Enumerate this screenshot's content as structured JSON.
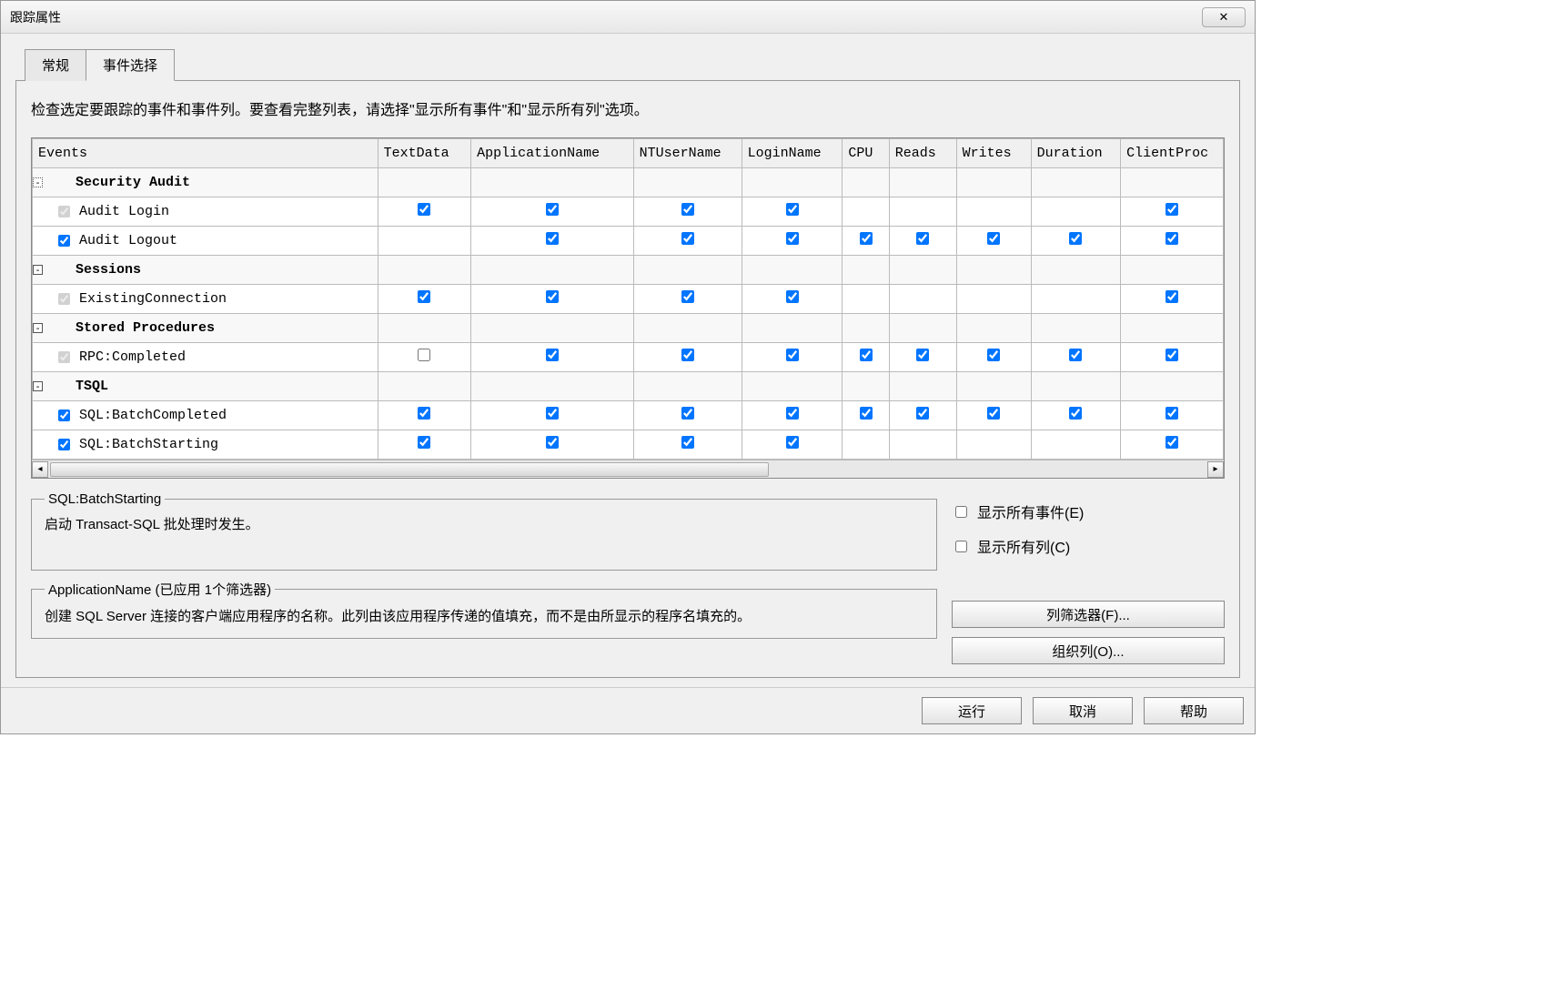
{
  "window": {
    "title": "跟踪属性",
    "close_glyph": "✕"
  },
  "tabs": {
    "general": "常规",
    "events": "事件选择"
  },
  "instruction": "检查选定要跟踪的事件和事件列。要查看完整列表，请选择\"显示所有事件\"和\"显示所有列\"选项。",
  "columns": {
    "events": "Events",
    "textdata": "TextData",
    "appname": "ApplicationName",
    "ntuser": "NTUserName",
    "login": "LoginName",
    "cpu": "CPU",
    "reads": "Reads",
    "writes": "Writes",
    "duration": "Duration",
    "client": "ClientProc"
  },
  "groups": [
    {
      "label": "Security Audit"
    },
    {
      "label": "Sessions"
    },
    {
      "label": "Stored Procedures"
    },
    {
      "label": "TSQL"
    }
  ],
  "rows": [
    {
      "group": 0,
      "label": "Audit Login",
      "chk": true,
      "disabled": true,
      "cells": {
        "textdata": true,
        "appname": true,
        "ntuser": true,
        "login": true,
        "cpu": null,
        "reads": null,
        "writes": null,
        "duration": null,
        "client": true
      }
    },
    {
      "group": 0,
      "label": "Audit Logout",
      "chk": true,
      "cells": {
        "textdata": null,
        "appname": true,
        "ntuser": true,
        "login": true,
        "cpu": true,
        "reads": true,
        "writes": true,
        "duration": true,
        "client": true
      }
    },
    {
      "group": 1,
      "label": "ExistingConnection",
      "chk": true,
      "disabled": true,
      "cells": {
        "textdata": true,
        "appname": true,
        "ntuser": true,
        "login": true,
        "cpu": null,
        "reads": null,
        "writes": null,
        "duration": null,
        "client": true
      }
    },
    {
      "group": 2,
      "label": "RPC:Completed",
      "chk": true,
      "disabled": true,
      "cells": {
        "textdata": false,
        "appname": true,
        "ntuser": true,
        "login": true,
        "cpu": true,
        "reads": true,
        "writes": true,
        "duration": true,
        "client": true
      }
    },
    {
      "group": 3,
      "label": "SQL:BatchCompleted",
      "chk": true,
      "cells": {
        "textdata": true,
        "appname": true,
        "ntuser": true,
        "login": true,
        "cpu": true,
        "reads": true,
        "writes": true,
        "duration": true,
        "client": true
      }
    },
    {
      "group": 3,
      "label": "SQL:BatchStarting",
      "chk": true,
      "cells": {
        "textdata": true,
        "appname": true,
        "ntuser": true,
        "login": true,
        "cpu": null,
        "reads": null,
        "writes": null,
        "duration": null,
        "client": true
      }
    }
  ],
  "desc1": {
    "legend": "SQL:BatchStarting",
    "text": "启动 Transact-SQL 批处理时发生。"
  },
  "desc2": {
    "legend": "ApplicationName (已应用 1个筛选器)",
    "text": "创建 SQL Server 连接的客户端应用程序的名称。此列由该应用程序传递的值填充，而不是由所显示的程序名填充的。"
  },
  "options": {
    "show_all_events": "显示所有事件(E)",
    "show_all_columns": "显示所有列(C)"
  },
  "buttons": {
    "column_filters": "列筛选器(F)...",
    "organize_columns": "组织列(O)...",
    "run": "运行",
    "cancel": "取消",
    "help": "帮助"
  }
}
